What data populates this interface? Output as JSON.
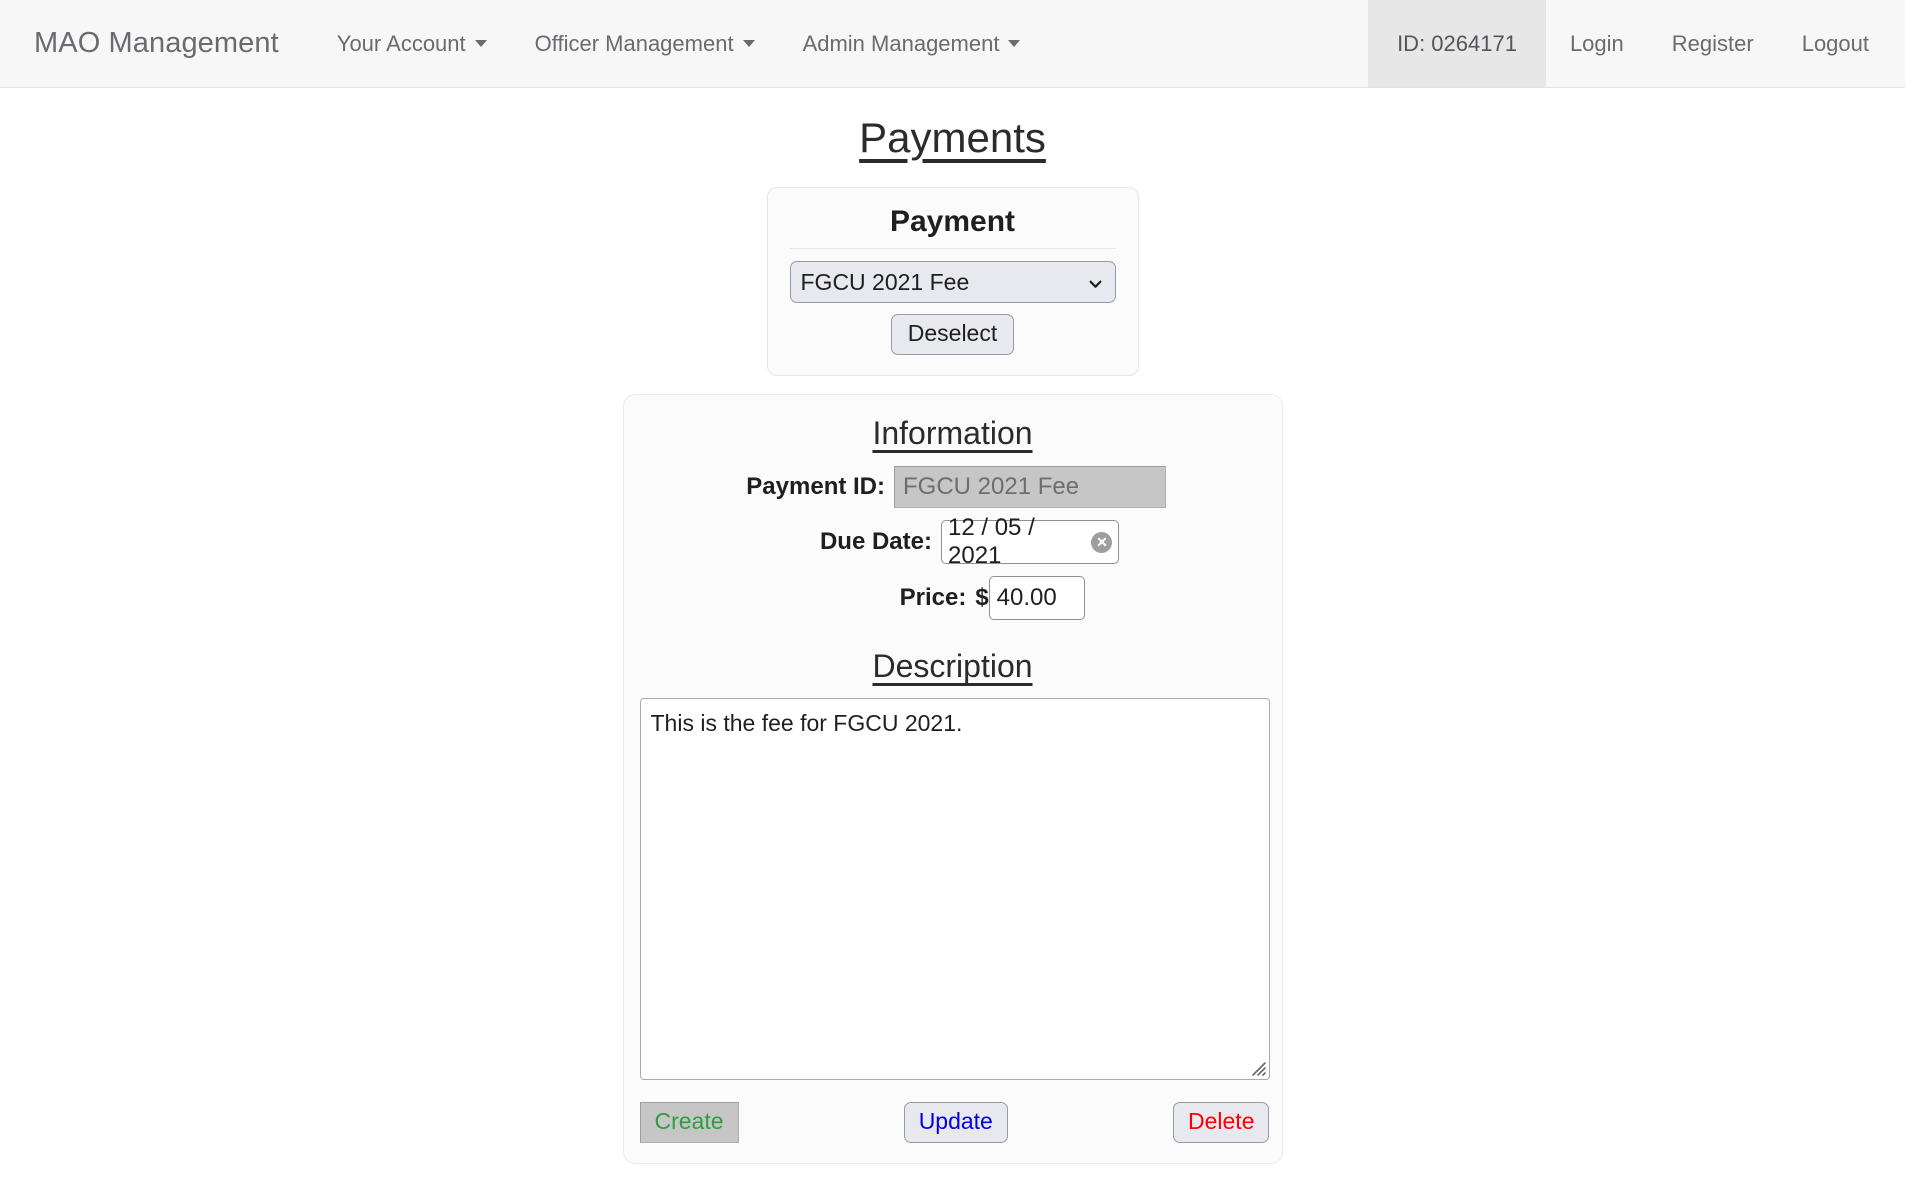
{
  "navbar": {
    "brand": "MAO Management",
    "menus": [
      {
        "label": "Your Account",
        "icon": "chevron-down-icon"
      },
      {
        "label": "Officer Management",
        "icon": "chevron-down-icon"
      },
      {
        "label": "Admin Management",
        "icon": "chevron-down-icon"
      }
    ],
    "id_badge": "ID: 0264171",
    "links": [
      {
        "label": "Login"
      },
      {
        "label": "Register"
      },
      {
        "label": "Logout"
      }
    ]
  },
  "page": {
    "title": "Payments"
  },
  "payment_card": {
    "heading": "Payment",
    "select": {
      "value": "FGCU 2021 Fee",
      "options": [
        "FGCU 2021 Fee"
      ],
      "icon": "chevron-down-icon"
    },
    "deselect_label": "Deselect"
  },
  "information": {
    "heading": "Information",
    "fields": {
      "payment_id": {
        "label": "Payment ID:",
        "value": "FGCU 2021 Fee",
        "placeholder": "",
        "disabled": true
      },
      "due_date": {
        "label": "Due Date:",
        "value": "12 / 05 / 2021",
        "clear_icon": "clear-circle-icon"
      },
      "price": {
        "label": "Price:",
        "currency": "$",
        "value": "40.00",
        "placeholder": ""
      }
    }
  },
  "description": {
    "heading": "Description",
    "value": "This is the fee for FGCU 2021.",
    "placeholder": "",
    "resize_icon": "resize-grip-icon"
  },
  "actions": {
    "create": {
      "label": "Create",
      "color": "#2e9e3e",
      "disabled": true
    },
    "update": {
      "label": "Update",
      "color": "#0000ee"
    },
    "delete": {
      "label": "Delete",
      "color": "#ff0000"
    }
  }
}
